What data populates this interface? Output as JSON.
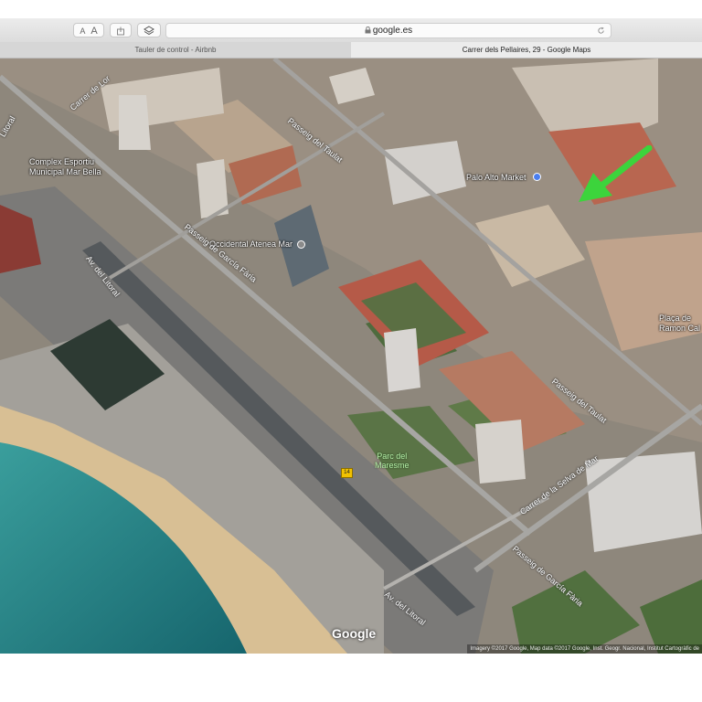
{
  "browser": {
    "url": "google.es",
    "font_small_label": "A",
    "font_large_label": "A",
    "tabs": [
      {
        "title": "Tauler de control - Airbnb"
      },
      {
        "title": "Carrer dels Pellaires, 29 - Google Maps"
      }
    ],
    "icons": [
      "share-icon",
      "layers-icon",
      "lock-icon",
      "reload-icon"
    ]
  },
  "map": {
    "view": "satellite",
    "places": [
      {
        "name": "Complex Esportiu Municipal Mar Bella"
      },
      {
        "name": "Palo Alto Market"
      },
      {
        "name": "Occidental Atenea Mar"
      },
      {
        "name": "Plaça de Ramon Cal"
      }
    ],
    "streets": [
      {
        "name": "Carrer de Lor"
      },
      {
        "name": "Passeig del Taulat"
      },
      {
        "name": "Passeig de García Fària"
      },
      {
        "name": "Av. del Litoral"
      },
      {
        "name": "Passeig del Taulat"
      },
      {
        "name": "Carrer de la Selva de Mar"
      },
      {
        "name": "Passeig de García Fària"
      },
      {
        "name": "Av. del Litoral"
      },
      {
        "name": "Litoral"
      }
    ],
    "parks": [
      {
        "name": "Parc del\nMaresme"
      }
    ],
    "road_shield": "14",
    "logo": "Google",
    "attribution": "Imagery ©2017 Google, Map data ©2017 Google, Inst. Geogr. Nacional, Institut Cartogràfic de",
    "marker_color": "#3cd43c"
  }
}
